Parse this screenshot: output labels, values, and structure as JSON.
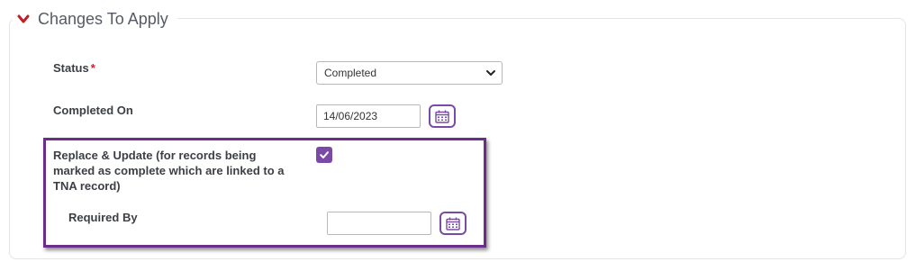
{
  "section": {
    "title": "Changes To Apply"
  },
  "fields": {
    "status": {
      "label": "Status",
      "required_mark": "*",
      "selected": "Completed"
    },
    "completed_on": {
      "label": "Completed On",
      "value": "14/06/2023"
    },
    "replace_update": {
      "label": "Replace & Update (for records being marked as complete which are linked to a TNA record)",
      "checked": true
    },
    "required_by": {
      "label": "Required By",
      "value": ""
    }
  },
  "colors": {
    "accent": "#7b4aa6",
    "highlight_border": "#6a2d8a",
    "required": "#d0202a",
    "chevron": "#c0202a"
  },
  "icons": [
    "chevron-down-icon",
    "calendar-icon",
    "checkmark-icon",
    "select-caret-icon"
  ]
}
